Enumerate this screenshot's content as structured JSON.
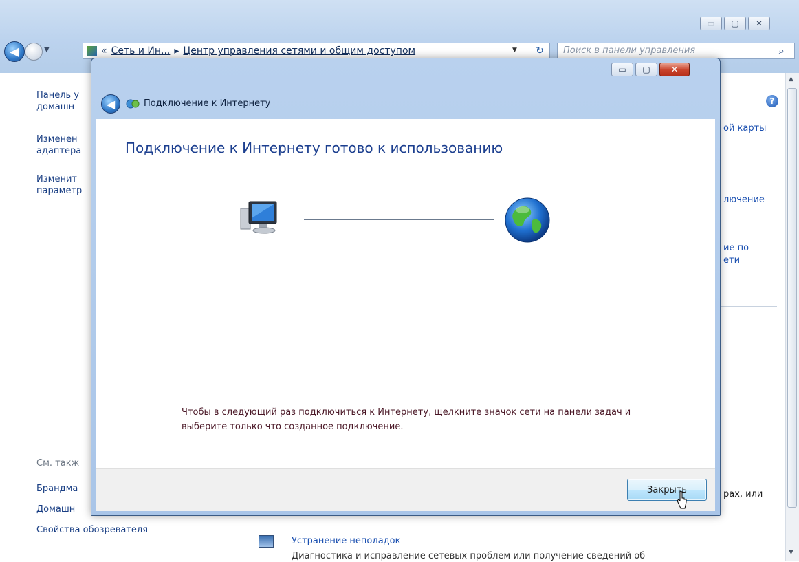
{
  "explorer": {
    "window_controls": {
      "minimize": "▭",
      "maximize": "▢",
      "close": "✕"
    },
    "address": {
      "chevrons": "«",
      "crumb1": "Сеть и Ин...",
      "sep": "▸",
      "crumb2": "Центр управления сетями и общим доступом"
    },
    "search_placeholder": "Поиск в панели управления",
    "sidebar": {
      "home_link": "Панель у\nдомашн",
      "link_adapter": "Изменен\nадаптера",
      "link_sharing": "Изменит\nпараметр",
      "see_also": "См. такж",
      "firewall": "Брандма",
      "homegroup": "Домашн",
      "browser_props": "Свойства обозревателя"
    },
    "main_fragments": {
      "map": "ой карты",
      "connection": "лючение",
      "params_line1": "ие по",
      "params_line2": "ети",
      "rooms": "рах, или",
      "troubleshoot": "Устранение неполадок",
      "troubleshoot_desc": "Диагностика и исправление сетевых проблем или получение сведений об"
    }
  },
  "wizard": {
    "window_controls": {
      "minimize": "▭",
      "maximize": "▢",
      "close": "✕"
    },
    "title": "Подключение к Интернету",
    "heading": "Подключение к Интернету готово к использованию",
    "hint": "Чтобы в следующий раз подключиться к Интернету, щелкните значок сети на панели задач и выберите только что созданное подключение.",
    "close_button": "Закрыть"
  },
  "colors": {
    "heading": "#1c3f8f",
    "hint_text": "#4a1726",
    "link": "#1a4fb0",
    "frame": "#b9d1ee"
  }
}
